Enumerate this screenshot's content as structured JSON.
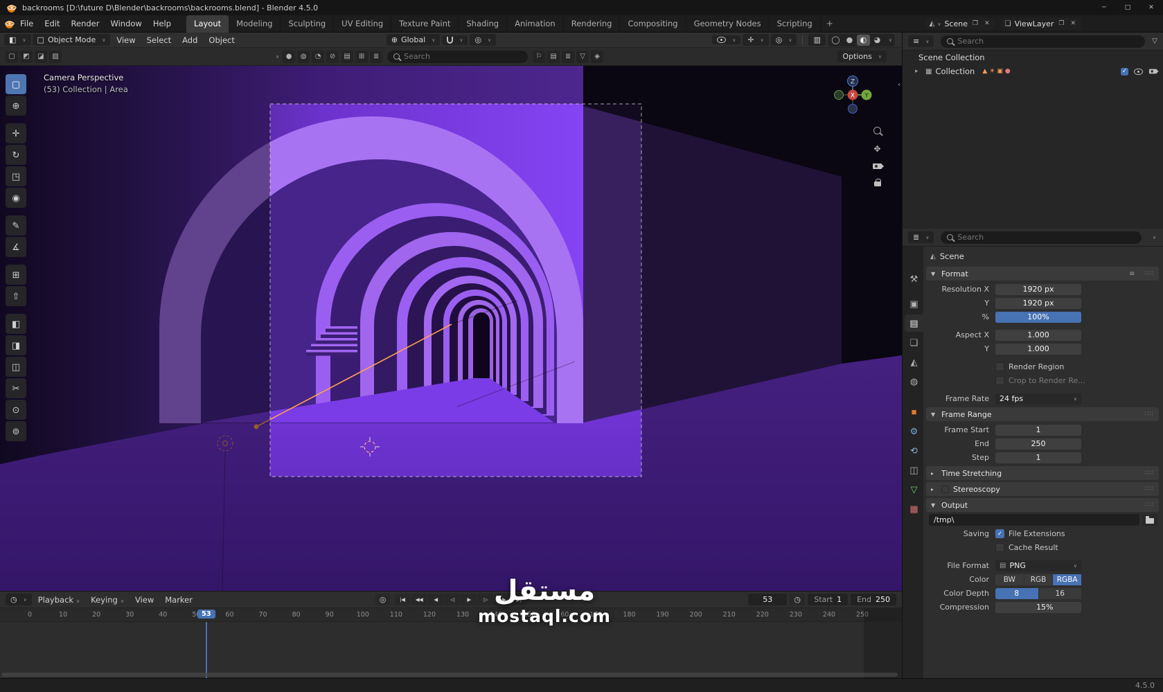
{
  "titlebar": {
    "title": "backrooms [D:\\future D\\Blender\\backrooms\\backrooms.blend] - Blender 4.5.0",
    "window_controls": {
      "minimize": "─",
      "maximize": "□",
      "close": "✕"
    }
  },
  "topbar": {
    "menus": [
      "File",
      "Edit",
      "Render",
      "Window",
      "Help"
    ],
    "workspaces": [
      "Layout",
      "Modeling",
      "Sculpting",
      "UV Editing",
      "Texture Paint",
      "Shading",
      "Animation",
      "Rendering",
      "Compositing",
      "Geometry Nodes",
      "Scripting"
    ],
    "active_workspace": "Layout",
    "add_workspace": "+",
    "scene_selector": {
      "icon": "◭",
      "label": "Scene",
      "new_icon": "❐",
      "unlink_icon": "✕"
    },
    "viewlayer_selector": {
      "icon": "❏",
      "label": "ViewLayer",
      "new_icon": "❐",
      "unlink_icon": "✕"
    }
  },
  "viewport": {
    "header": {
      "editor_icon": "◧",
      "mode_icon": "□",
      "mode": "Object Mode",
      "menus": [
        "View",
        "Select",
        "Add",
        "Object"
      ],
      "orientation_icon": "⊕",
      "orientation": "Global",
      "proportional_icon": "◎",
      "right_icons": [
        {
          "name": "gizmos-toggle",
          "glyph": "✛"
        },
        {
          "name": "overlays-toggle",
          "glyph": "◎"
        },
        {
          "name": "xray-toggle",
          "glyph": "▥"
        }
      ],
      "shading_modes": [
        {
          "name": "shading-wireframe",
          "glyph": "◯"
        },
        {
          "name": "shading-solid",
          "glyph": "●"
        },
        {
          "name": "shading-material",
          "glyph": "◐",
          "active": true
        },
        {
          "name": "shading-rendered",
          "glyph": "◕"
        }
      ]
    },
    "tool_row": {
      "select_mode_icons": [
        "▢",
        "◩",
        "◪",
        "▨"
      ],
      "icons": [
        "●",
        "◍",
        "◔",
        "⊘",
        "▤",
        "⊞",
        "≣"
      ],
      "search_placeholder": "Search",
      "after_icons": [
        "⚐",
        "▤",
        "≣",
        "▽",
        "◈"
      ],
      "options": "Options"
    },
    "tools": [
      {
        "name": "select-box",
        "glyph": "▢",
        "active": true
      },
      {
        "name": "cursor",
        "glyph": "⊕"
      },
      {
        "name": "move",
        "glyph": "✛"
      },
      {
        "name": "rotate",
        "glyph": "↻"
      },
      {
        "name": "scale",
        "glyph": "◳"
      },
      {
        "name": "transform",
        "glyph": "◉"
      },
      {
        "name": "annotate",
        "glyph": "✎"
      },
      {
        "name": "measure",
        "glyph": "∡"
      },
      {
        "name": "add-cube",
        "glyph": "⊞"
      },
      {
        "name": "extrude",
        "glyph": "⇧"
      },
      {
        "name": "paint-a",
        "glyph": "◧"
      },
      {
        "name": "paint-b",
        "glyph": "◨"
      },
      {
        "name": "loop-cut",
        "glyph": "◫"
      },
      {
        "name": "knife",
        "glyph": "✂"
      },
      {
        "name": "sample-a",
        "glyph": "⊙"
      },
      {
        "name": "sample-b",
        "glyph": "⊚"
      }
    ],
    "overlay": {
      "view_name": "Camera Perspective",
      "context_info": "(53) Collection | Area"
    },
    "gizmo": {
      "x": "X",
      "y": "Y",
      "z": "Z"
    }
  },
  "outliner": {
    "editor_icon": "≡",
    "search_placeholder": "Search",
    "filter_icon": "▽",
    "root_label": "Scene Collection",
    "collection": {
      "label": "Collection",
      "content_icons": [
        {
          "name": "mesh-data-icon",
          "glyph": "▲",
          "color": "#ff9e5a"
        },
        {
          "name": "light-data-icon",
          "glyph": "☀",
          "color": "#ff9e5a"
        },
        {
          "name": "camera-data-icon",
          "glyph": "▣",
          "color": "#ff9e5a"
        },
        {
          "name": "material-icon",
          "glyph": "●",
          "color": "#e87a7a"
        }
      ]
    }
  },
  "properties": {
    "editor_icon": "≣",
    "search_placeholder": "Search",
    "breadcrumb_icon": "◭",
    "breadcrumb": "Scene",
    "tabs": [
      {
        "name": "tab-tool",
        "glyph": "⚒"
      },
      {
        "name": "tab-render",
        "glyph": "▣"
      },
      {
        "name": "tab-output",
        "glyph": "▤",
        "active": true
      },
      {
        "name": "tab-view-layer",
        "glyph": "❏"
      },
      {
        "name": "tab-scene",
        "glyph": "◭"
      },
      {
        "name": "tab-world",
        "glyph": "◍"
      },
      {
        "name": "tab-object",
        "glyph": "■",
        "color": "#e8792e"
      },
      {
        "name": "tab-modifiers",
        "glyph": "⚙",
        "color": "#7aa8d8"
      },
      {
        "name": "tab-physics",
        "glyph": "⟲",
        "color": "#8fb4d8"
      },
      {
        "name": "tab-constraints",
        "glyph": "◫"
      },
      {
        "name": "tab-object-data",
        "glyph": "▽",
        "color": "#6fc76f"
      },
      {
        "name": "tab-texture",
        "glyph": "▦",
        "color": "#d87070"
      }
    ],
    "format": {
      "title": "Format",
      "resolution_x_label": "Resolution X",
      "resolution_x": "1920 px",
      "resolution_y_label": "Y",
      "resolution_y": "1920 px",
      "percent_label": "%",
      "percent": "100%",
      "aspect_x_label": "Aspect X",
      "aspect_x": "1.000",
      "aspect_y_label": "Y",
      "aspect_y": "1.000",
      "render_region_label": "Render Region",
      "crop_label": "Crop to Render Re...",
      "frame_rate_label": "Frame Rate",
      "frame_rate": "24 fps"
    },
    "frame_range": {
      "title": "Frame Range",
      "start_label": "Frame Start",
      "start": "1",
      "end_label": "End",
      "end": "250",
      "step_label": "Step",
      "step": "1"
    },
    "time_stretching_label": "Time Stretching",
    "stereoscopy_label": "Stereoscopy",
    "output": {
      "title": "Output",
      "path": "/tmp\\",
      "saving_label": "Saving",
      "file_extensions_label": "File Extensions",
      "cache_result_label": "Cache Result",
      "file_format_label": "File Format",
      "file_format_icon": "▤",
      "file_format": "PNG",
      "color_label": "Color",
      "color_modes": [
        "BW",
        "RGB",
        "RGBA"
      ],
      "color_active": "RGBA",
      "depth_label": "Color Depth",
      "depth_modes": [
        "8",
        "16"
      ],
      "depth_active": "8",
      "compression_label": "Compression",
      "compression": "15%",
      "compression_pct": 15
    }
  },
  "timeline": {
    "editor_icon": "◷",
    "menu_playback": "Playback",
    "menu_keying": "Keying",
    "menu_view": "View",
    "menu_marker": "Marker",
    "autokey_icon": "◎",
    "playback": [
      {
        "name": "jump-to-start",
        "glyph": "|◀"
      },
      {
        "name": "prev-keyframe",
        "glyph": "◀◀"
      },
      {
        "name": "prev-frame",
        "glyph": "◀"
      },
      {
        "name": "play-reverse",
        "glyph": "◁"
      },
      {
        "name": "play",
        "glyph": "▶"
      },
      {
        "name": "next-frame",
        "glyph": "▷"
      },
      {
        "name": "next-keyframe",
        "glyph": "▶▶"
      },
      {
        "name": "jump-to-end",
        "glyph": "▶|"
      }
    ],
    "current_frame": "53",
    "clock_icon": "◷",
    "start_label": "Start",
    "start": "1",
    "end_label": "End",
    "end": "250",
    "ticks": [
      "0",
      "10",
      "20",
      "30",
      "40",
      "50",
      "60",
      "70",
      "80",
      "90",
      "100",
      "110",
      "120",
      "130",
      "140",
      "150",
      "160",
      "170",
      "180",
      "190",
      "200",
      "210",
      "220",
      "230",
      "240",
      "250"
    ]
  },
  "watermark": {
    "arabic": "مستقل",
    "domain": "mostaql.com"
  },
  "statusbar": {
    "version": "4.5.0"
  },
  "colors": {
    "accent": "#4772b3",
    "selection_orange": "#ffa14f",
    "scene_purple": "#7a3ce6",
    "object_orange": "#e8792e"
  }
}
